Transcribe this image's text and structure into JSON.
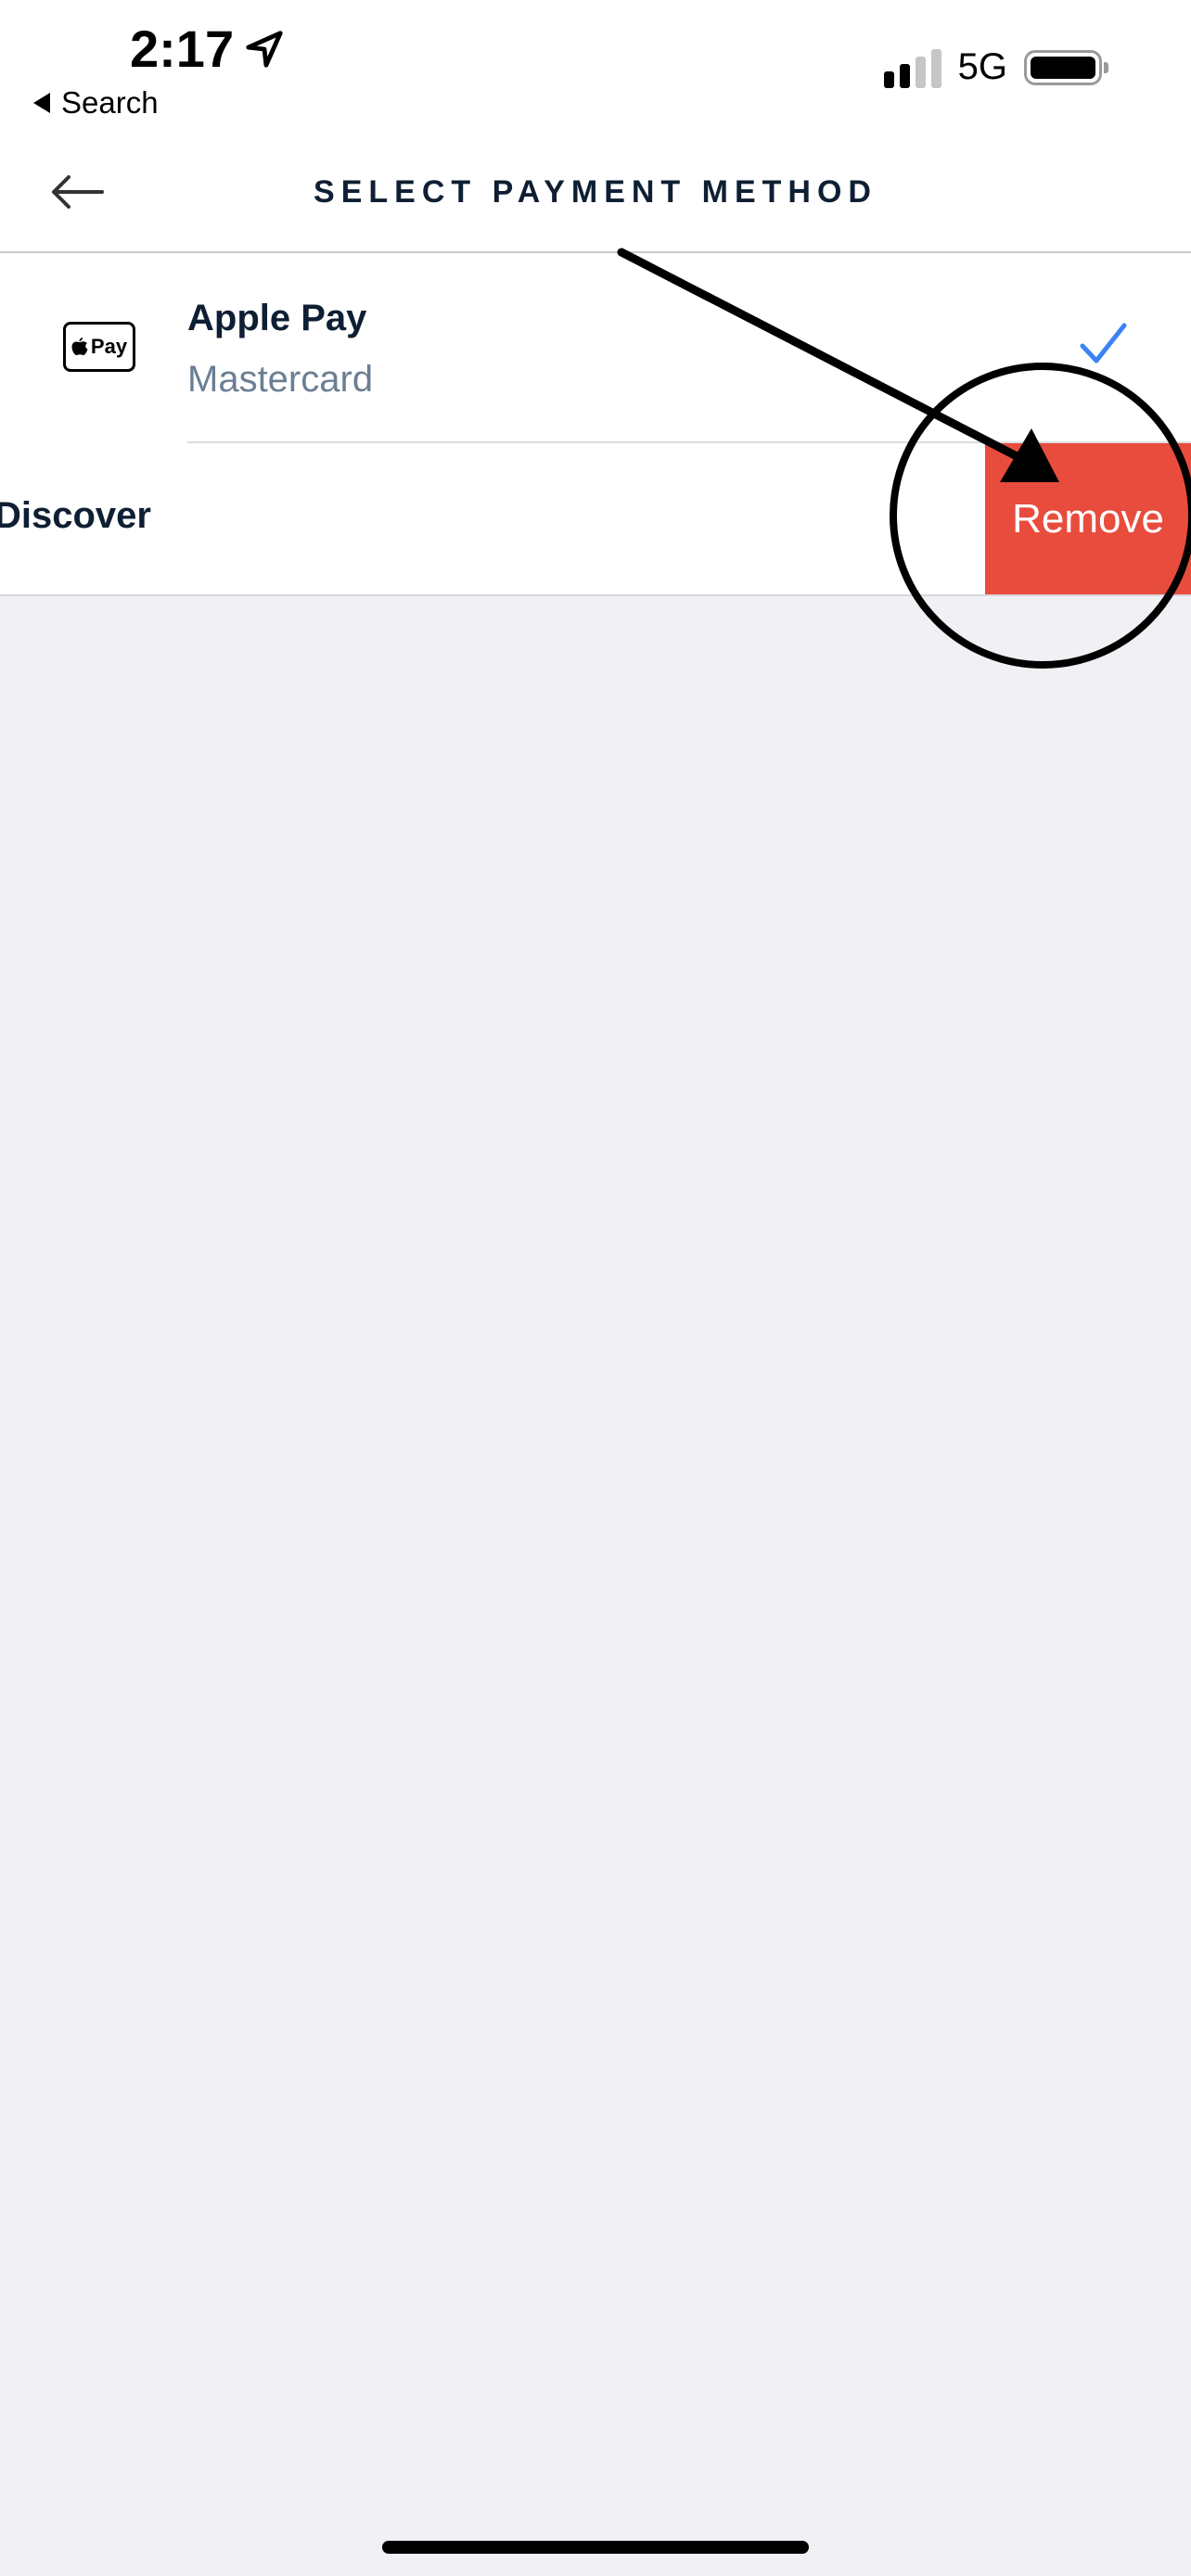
{
  "status_bar": {
    "time": "2:17",
    "back_app": "Search",
    "network": "5G",
    "signal_bars_active": 2,
    "signal_bars_total": 4,
    "battery_level": 1.0
  },
  "nav": {
    "title": "SELECT PAYMENT METHOD"
  },
  "payment_methods": [
    {
      "title": "Apple Pay",
      "subtitle": "Mastercard",
      "logo_text": "Pay",
      "selected": true
    },
    {
      "title": "Discover ••",
      "selected": false
    }
  ],
  "actions": {
    "remove_label": "Remove"
  },
  "colors": {
    "remove": "#e84c3d",
    "check": "#3b82f6",
    "title": "#0f1f33",
    "subtitle": "#6b7f93",
    "background": "#f0f0f5"
  }
}
